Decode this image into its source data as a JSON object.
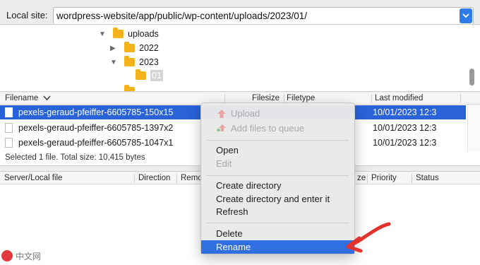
{
  "local_site": {
    "label": "Local site:",
    "path": "wordpress-website/app/public/wp-content/uploads/2023/01/"
  },
  "tree": {
    "items": [
      {
        "label": "uploads",
        "state": "expanded"
      },
      {
        "label": "2022",
        "state": "collapsed"
      },
      {
        "label": "2023",
        "state": "expanded"
      },
      {
        "label": "01",
        "state": "selected"
      }
    ]
  },
  "file_list": {
    "columns": [
      "Filename",
      "Filesize",
      "Filetype",
      "Last modified"
    ],
    "rows": [
      {
        "name": "pexels-geraud-pfeiffer-6605785-150x15",
        "modified": "10/01/2023 12:3",
        "selected": true
      },
      {
        "name": "pexels-geraud-pfeiffer-6605785-1397x2",
        "modified": "10/01/2023 12:3",
        "selected": false
      },
      {
        "name": "pexels-geraud-pfeiffer-6605785-1047x1",
        "modified": "10/01/2023 12:3",
        "selected": false
      }
    ],
    "status": "Selected 1 file. Total size: 10,415 bytes"
  },
  "queue": {
    "columns": [
      "Server/Local file",
      "Direction",
      "Remo",
      "ze",
      "Priority",
      "Status"
    ]
  },
  "context_menu": {
    "upload": "Upload",
    "add_to_queue": "Add files to queue",
    "open": "Open",
    "edit": "Edit",
    "create_directory": "Create directory",
    "create_directory_enter": "Create directory and enter it",
    "refresh": "Refresh",
    "delete": "Delete",
    "rename": "Rename"
  },
  "watermark": {
    "text": "中文网"
  },
  "colors": {
    "selection": "#2962d9",
    "menu_highlight": "#2f6fe0",
    "folder": "#f3b21c",
    "annotation_arrow": "#e2342c"
  }
}
